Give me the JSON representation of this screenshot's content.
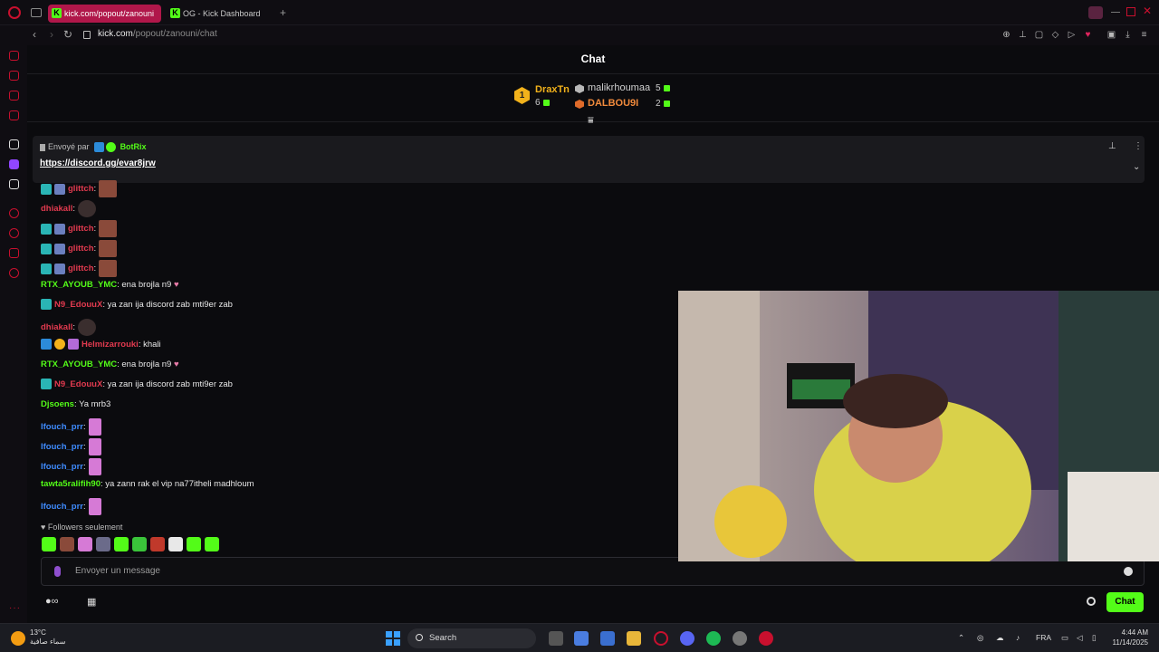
{
  "browser": {
    "tabs": [
      {
        "label": "kick.com/popout/zanouni"
      },
      {
        "label": "OG - Kick Dashboard"
      }
    ],
    "new_tab": "+",
    "url_host": "kick.com",
    "url_path": "/popout/zanouni/chat"
  },
  "chat": {
    "title": "Chat",
    "leaderboard": {
      "first": {
        "rank": "1",
        "name": "DraxTn",
        "count": "6"
      },
      "second": {
        "name": "malikrhoumaa",
        "count": "5"
      },
      "third": {
        "name": "DALBOU9I",
        "count": "2"
      }
    },
    "pinned": {
      "sent_by": "Envoyé par",
      "sender": "BotRix",
      "link": "https://discord.gg/evar8jrw"
    },
    "messages": [
      {
        "user": "glittch",
        "text": ":",
        "color": "#e23a4f"
      },
      {
        "user": "dhiakall",
        "text": ":",
        "color": "#e23a4f"
      },
      {
        "user": "glittch",
        "text": ":",
        "color": "#e23a4f"
      },
      {
        "user": "glittch",
        "text": ":",
        "color": "#e23a4f"
      },
      {
        "user": "glittch",
        "text": ":",
        "color": "#e23a4f"
      },
      {
        "user": "RTX_AYOUB_YMC",
        "text": ": ena brojla n9",
        "color": "#53fc18"
      },
      {
        "user": "N9_EdouuX",
        "text": ": ya zan ija discord zab mti9er zab",
        "color": "#e23a4f"
      },
      {
        "user": "dhiakall",
        "text": ":",
        "color": "#e23a4f"
      },
      {
        "user": "Helmizarrouki",
        "text": ": khali",
        "color": "#e23a4f"
      },
      {
        "user": "RTX_AYOUB_YMC",
        "text": ": ena brojla n9",
        "color": "#53fc18"
      },
      {
        "user": "N9_EdouuX",
        "text": ": ya zan ija discord zab mti9er zab",
        "color": "#e23a4f"
      },
      {
        "user": "Djsoens",
        "text": ": Ya mrb3",
        "color": "#53fc18"
      },
      {
        "user": "lfouch_prr",
        "text": ":",
        "color": "#3f8cff"
      },
      {
        "user": "lfouch_prr",
        "text": ":",
        "color": "#3f8cff"
      },
      {
        "user": "lfouch_prr",
        "text": ":",
        "color": "#3f8cff"
      },
      {
        "user": "tawta5ralifih90",
        "text": ": ya zann rak el vip na77itheli madhloum",
        "color": "#53fc18"
      },
      {
        "user": "lfouch_prr",
        "text": ":",
        "color": "#3f8cff"
      }
    ],
    "followers_only": "Followers seulement",
    "input_placeholder": "Envoyer un message",
    "send_label": "Chat"
  },
  "taskbar": {
    "weather_temp": "13°C",
    "weather_desc": "سماء صافية",
    "search_label": "Search",
    "lang": "FRA",
    "time": "4:44 AM",
    "date": "11/14/2025"
  },
  "colors": {
    "kick_green": "#53fc18",
    "opera_red": "#c8102e",
    "tab_active": "#b0174a"
  }
}
